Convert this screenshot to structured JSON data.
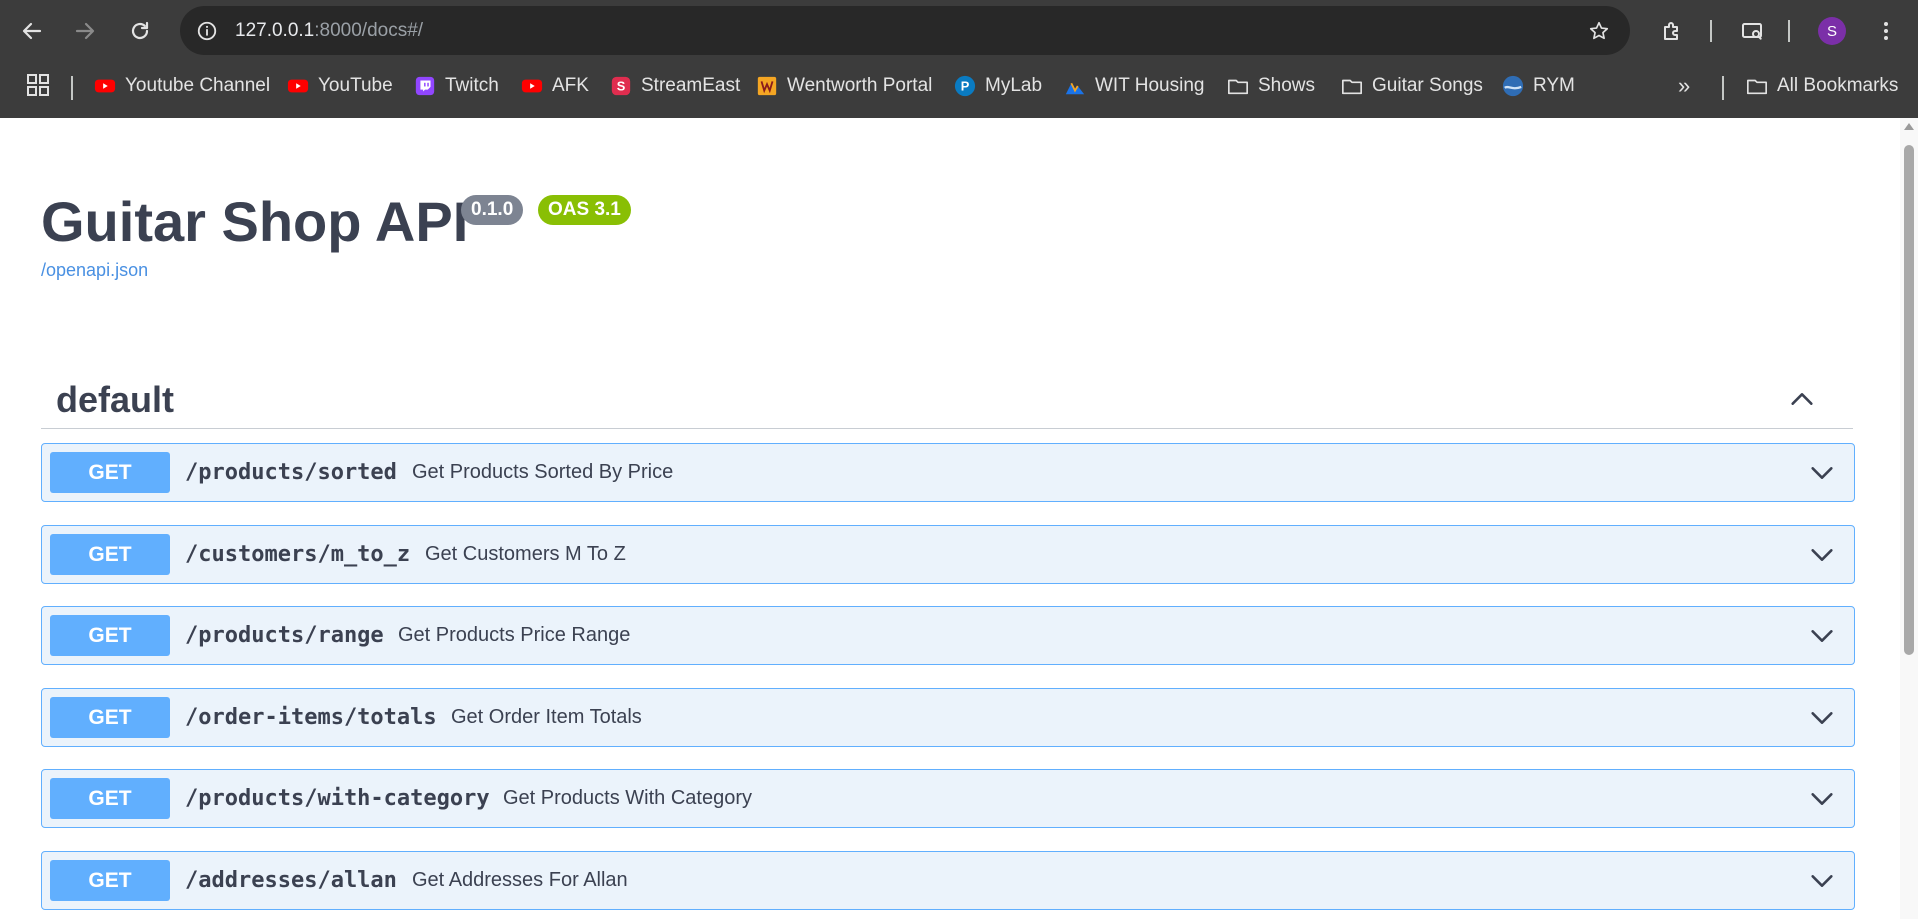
{
  "browser": {
    "url_host": "127.0.0.1",
    "url_rest": ":8000/docs#/",
    "profile_initial": "S",
    "bookmarks": [
      {
        "label": "Youtube Channel",
        "icon": "youtube-icon"
      },
      {
        "label": "YouTube",
        "icon": "youtube-icon"
      },
      {
        "label": "Twitch",
        "icon": "twitch-icon"
      },
      {
        "label": "AFK",
        "icon": "youtube-icon"
      },
      {
        "label": "StreamEast",
        "icon": "streameast-icon"
      },
      {
        "label": "Wentworth Portal",
        "icon": "wentworth-icon"
      },
      {
        "label": "MyLab",
        "icon": "pearson-icon"
      },
      {
        "label": "WIT Housing",
        "icon": "housing-icon"
      },
      {
        "label": "Shows",
        "icon": "folder-icon"
      },
      {
        "label": "Guitar Songs",
        "icon": "folder-icon"
      },
      {
        "label": "RYM",
        "icon": "rym-icon"
      }
    ],
    "more_bookmarks": "»",
    "all_bookmarks": "All Bookmarks"
  },
  "api": {
    "title": "Guitar Shop API",
    "version": "0.1.0",
    "oas": "OAS 3.1",
    "spec_link": "/openapi.json",
    "tag": "default",
    "operations": [
      {
        "method": "GET",
        "path": "/products/sorted",
        "summary": "Get Products Sorted By Price"
      },
      {
        "method": "GET",
        "path": "/customers/m_to_z",
        "summary": "Get Customers M To Z"
      },
      {
        "method": "GET",
        "path": "/products/range",
        "summary": "Get Products Price Range"
      },
      {
        "method": "GET",
        "path": "/order-items/totals",
        "summary": "Get Order Item Totals"
      },
      {
        "method": "GET",
        "path": "/products/with-category",
        "summary": "Get Products With Category"
      },
      {
        "method": "GET",
        "path": "/addresses/allan",
        "summary": "Get Addresses For Allan"
      }
    ]
  },
  "colors": {
    "get_accent": "#61affe",
    "get_background": "#ebf3fb",
    "version_badge": "#7d8492",
    "oas_badge": "#89bf04",
    "link": "#4990e2",
    "text": "#3b4151"
  }
}
